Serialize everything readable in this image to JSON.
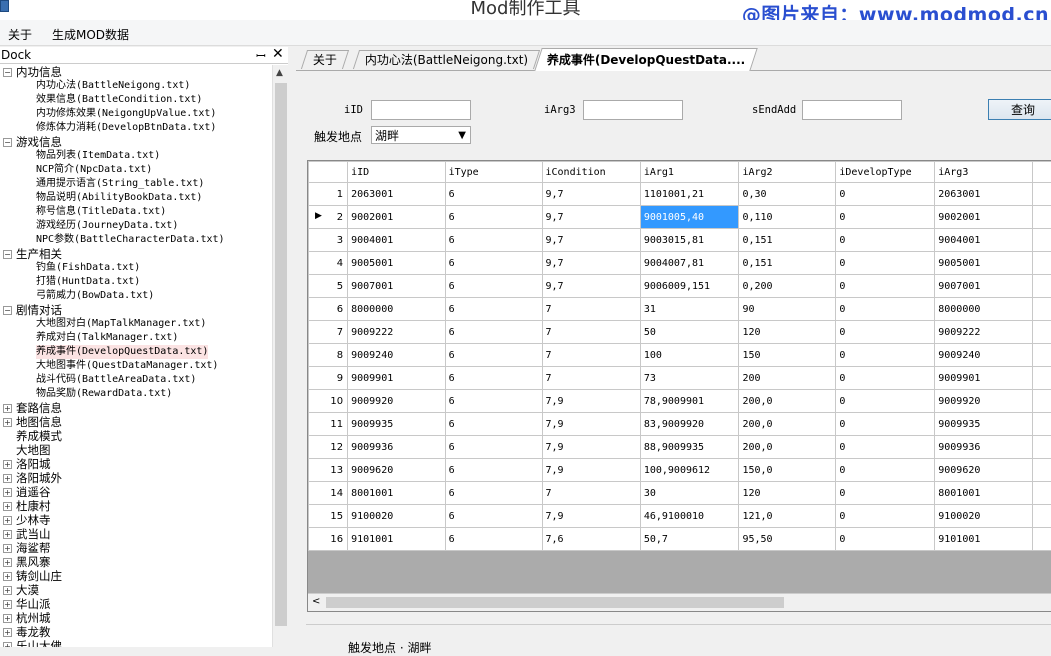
{
  "window": {
    "title": "Mod制作工具",
    "watermark": "@图片来自：www.modmod.cn"
  },
  "menu": [
    "关于",
    "生成MOD数据"
  ],
  "dock": {
    "title": "Dock",
    "pin": "ꟷ",
    "close": "✕",
    "tree": [
      {
        "label": "内功信息",
        "type": "cat",
        "expanded": true
      },
      {
        "label": "内功心法(BattleNeigong.txt)",
        "type": "leaf"
      },
      {
        "label": "效果信息(BattleCondition.txt)",
        "type": "leaf"
      },
      {
        "label": "内功修炼效果(NeigongUpValue.txt)",
        "type": "leaf"
      },
      {
        "label": "修炼体力消耗(DevelopBtnData.txt)",
        "type": "leaf"
      },
      {
        "label": "游戏信息",
        "type": "cat",
        "expanded": true
      },
      {
        "label": "物品列表(ItemData.txt)",
        "type": "leaf"
      },
      {
        "label": "NCP简介(NpcData.txt)",
        "type": "leaf"
      },
      {
        "label": "通用提示语言(String_table.txt)",
        "type": "leaf"
      },
      {
        "label": "物品说明(AbilityBookData.txt)",
        "type": "leaf"
      },
      {
        "label": "称号信息(TitleData.txt)",
        "type": "leaf"
      },
      {
        "label": "游戏经历(JourneyData.txt)",
        "type": "leaf"
      },
      {
        "label": "NPC参数(BattleCharacterData.txt)",
        "type": "leaf"
      },
      {
        "label": "生产相关",
        "type": "cat",
        "expanded": true
      },
      {
        "label": "钓鱼(FishData.txt)",
        "type": "leaf"
      },
      {
        "label": "打猎(HuntData.txt)",
        "type": "leaf"
      },
      {
        "label": "弓箭威力(BowData.txt)",
        "type": "leaf"
      },
      {
        "label": "剧情对话",
        "type": "cat",
        "expanded": true
      },
      {
        "label": "大地图对白(MapTalkManager.txt)",
        "type": "leaf"
      },
      {
        "label": "养成对白(TalkManager.txt)",
        "type": "leaf"
      },
      {
        "label": "养成事件(DevelopQuestData.txt)",
        "type": "leaf",
        "selected": true
      },
      {
        "label": "大地图事件(QuestDataManager.txt)",
        "type": "leaf"
      },
      {
        "label": "战斗代码(BattleAreaData.txt)",
        "type": "leaf"
      },
      {
        "label": "物品奖励(RewardData.txt)",
        "type": "leaf"
      },
      {
        "label": "套路信息",
        "type": "cat",
        "expanded": false
      },
      {
        "label": "地图信息",
        "type": "cat",
        "expanded": false
      },
      {
        "label": "养成模式",
        "type": "cat",
        "expanded": null
      },
      {
        "label": "大地图",
        "type": "cat",
        "expanded": null
      },
      {
        "label": "洛阳城",
        "type": "cat",
        "expanded": false
      },
      {
        "label": "洛阳城外",
        "type": "cat",
        "expanded": false
      },
      {
        "label": "逍遥谷",
        "type": "cat",
        "expanded": false
      },
      {
        "label": "杜康村",
        "type": "cat",
        "expanded": false
      },
      {
        "label": "少林寺",
        "type": "cat",
        "expanded": false
      },
      {
        "label": "武当山",
        "type": "cat",
        "expanded": false
      },
      {
        "label": "海鲨帮",
        "type": "cat",
        "expanded": false
      },
      {
        "label": "黑风寨",
        "type": "cat",
        "expanded": false
      },
      {
        "label": "铸剑山庄",
        "type": "cat",
        "expanded": false
      },
      {
        "label": "大漠",
        "type": "cat",
        "expanded": false
      },
      {
        "label": "华山派",
        "type": "cat",
        "expanded": false
      },
      {
        "label": "杭州城",
        "type": "cat",
        "expanded": false
      },
      {
        "label": "毒龙教",
        "type": "cat",
        "expanded": false
      },
      {
        "label": "乐山大佛",
        "type": "cat",
        "expanded": false
      }
    ]
  },
  "tabs": [
    {
      "label": "关于",
      "active": false
    },
    {
      "label": "内功心法(BattleNeigong.txt)",
      "active": false
    },
    {
      "label": "养成事件(DevelopQuestData....",
      "active": true
    }
  ],
  "search": {
    "iID_label": "iID",
    "iID_value": "",
    "iArg3_label": "iArg3",
    "iArg3_value": "",
    "sEndAdd_label": "sEndAdd",
    "sEndAdd_value": "",
    "location_label": "触发地点",
    "location_value": "湖畔",
    "query_button": "查询"
  },
  "grid": {
    "columns": [
      "iID",
      "iType",
      "iCondition",
      "iArg1",
      "iArg2",
      "iDevelopType",
      "iArg3"
    ],
    "rows": [
      [
        "2063001",
        "6",
        "9,7",
        "1101001,21",
        "0,30",
        "0",
        "2063001"
      ],
      [
        "9002001",
        "6",
        "9,7",
        "9001005,40",
        "0,110",
        "0",
        "9002001"
      ],
      [
        "9004001",
        "6",
        "9,7",
        "9003015,81",
        "0,151",
        "0",
        "9004001"
      ],
      [
        "9005001",
        "6",
        "9,7",
        "9004007,81",
        "0,151",
        "0",
        "9005001"
      ],
      [
        "9007001",
        "6",
        "9,7",
        "9006009,151",
        "0,200",
        "0",
        "9007001"
      ],
      [
        "8000000",
        "6",
        "7",
        "31",
        "90",
        "0",
        "8000000"
      ],
      [
        "9009222",
        "6",
        "7",
        "50",
        "120",
        "0",
        "9009222"
      ],
      [
        "9009240",
        "6",
        "7",
        "100",
        "150",
        "0",
        "9009240"
      ],
      [
        "9009901",
        "6",
        "7",
        "73",
        "200",
        "0",
        "9009901"
      ],
      [
        "9009920",
        "6",
        "7,9",
        "78,9009901",
        "200,0",
        "0",
        "9009920"
      ],
      [
        "9009935",
        "6",
        "7,9",
        "83,9009920",
        "200,0",
        "0",
        "9009935"
      ],
      [
        "9009936",
        "6",
        "7,9",
        "88,9009935",
        "200,0",
        "0",
        "9009936"
      ],
      [
        "9009620",
        "6",
        "7,9",
        "100,9009612",
        "150,0",
        "0",
        "9009620"
      ],
      [
        "8001001",
        "6",
        "7",
        "30",
        "120",
        "0",
        "8001001"
      ],
      [
        "9100020",
        "6",
        "7,9",
        "46,9100010",
        "121,0",
        "0",
        "9100020"
      ],
      [
        "9101001",
        "6",
        "7,6",
        "50,7",
        "95,50",
        "0",
        "9101001"
      ]
    ],
    "selected_row": 1,
    "selected_col": 3,
    "current_row_marker": "▶",
    "scroll_left_arrow": "<"
  },
  "bottom": {
    "text": "触发地点 · 湖畔"
  }
}
